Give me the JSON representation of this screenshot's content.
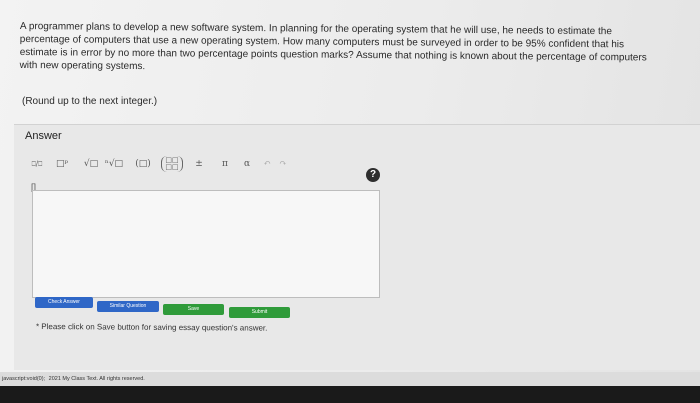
{
  "question": {
    "lines": [
      "A programmer plans to develop a new software system. In planning for the operating system that he will use, he needs to estimate the",
      "percentage of computers that use a new operating system. How many computers must be surveyed in order to be 95% confident that his",
      "estimate is in error by no more than two percentage points question marks? Assume that nothing is known about the percentage of computers",
      "with new operating systems."
    ],
    "hint": "(Round up to the next integer.)"
  },
  "answer": {
    "label": "Answer",
    "toolbar": {
      "fraction": "⎕/⎕",
      "power": "□ᵖ",
      "sqrt": "√□",
      "nthroot": "ⁿ√□",
      "paren": "(□)",
      "matrix_top": "□□",
      "matrix_bottom": "□□",
      "plusminus": "±",
      "pi": "π",
      "alpha": "α",
      "undo": "↶",
      "redo": "↷"
    },
    "help": "?",
    "cursor": "[]"
  },
  "buttons": {
    "check": "Check Answer",
    "similar": "Similar Question",
    "save": "Save",
    "submit": "Submit"
  },
  "note": "* Please click on Save button for saving essay question's answer.",
  "status": {
    "link": "javascript:void(0);",
    "copyright": "2021 My Class Text. All rights reserved."
  },
  "colors": {
    "blue_button": "#2f67c7",
    "green_button": "#2f9b3a"
  }
}
